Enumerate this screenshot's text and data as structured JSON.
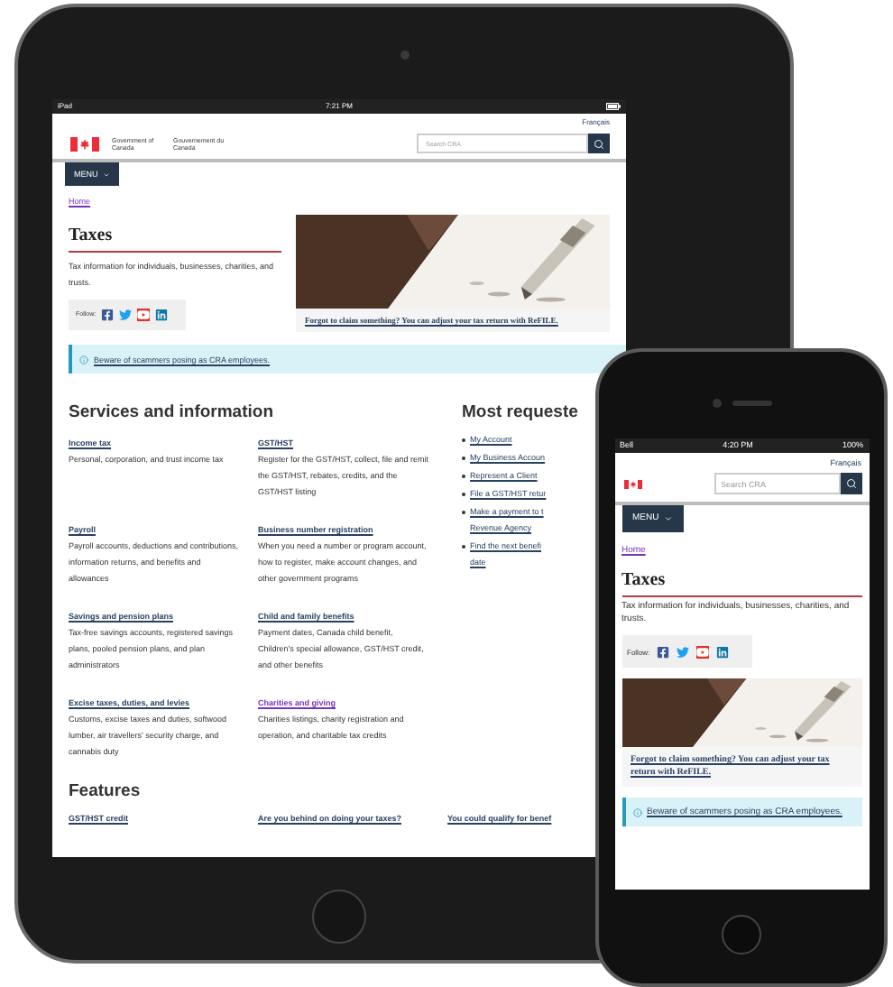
{
  "tablet": {
    "status_bar": {
      "carrier": "iPad",
      "time": "7:21 PM"
    },
    "header": {
      "language_link": "Français",
      "wordmark_en": "Government of Canada",
      "wordmark_fr": "Gouvernement du Canada",
      "search": {
        "placeholder": "Search CRA"
      },
      "menu": "MENU"
    },
    "breadcrumb": "Home",
    "title": "Taxes",
    "intro": "Tax information for individuals, businesses, charities, and trusts.",
    "follow_label": "Follow:",
    "feature_caption": "Forgot to claim something? You can adjust your tax return with ReFILE.",
    "alert": "Beware of scammers posing as CRA employees.",
    "services": {
      "heading": "Services and information",
      "items": [
        {
          "title": "Income tax",
          "visited": false,
          "description": "Personal, corporation, and trust income tax"
        },
        {
          "title": "GST/HST",
          "visited": false,
          "description": "Register for the GST/HST, collect, file and remit the GST/HST, rebates, credits, and the GST/HST listing"
        },
        {
          "title": "Payroll",
          "visited": false,
          "description": "Payroll accounts, deductions and contributions, information returns, and benefits and allowances"
        },
        {
          "title": "Business number registration",
          "visited": false,
          "description": "When you need a number or program account, how to register, make account changes, and other government programs"
        },
        {
          "title": "Savings and pension plans",
          "visited": false,
          "description": "Tax-free savings accounts, registered savings plans, pooled pension plans, and plan administrators"
        },
        {
          "title": "Child and family benefits",
          "visited": false,
          "description": "Payment dates, Canada child benefit, Children's special allowance, GST/HST credit, and other benefits"
        },
        {
          "title": "Excise taxes, duties, and levies",
          "visited": false,
          "description": "Customs, excise taxes and duties, softwood lumber, air travellers' security charge, and cannabis duty"
        },
        {
          "title": "Charities and giving",
          "visited": true,
          "description": "Charities listings, charity registration and operation, and charitable tax credits"
        }
      ]
    },
    "most_requested": {
      "heading": "Most requeste",
      "items": [
        {
          "lines": [
            "My Account"
          ]
        },
        {
          "lines": [
            "My Business Accoun"
          ]
        },
        {
          "lines": [
            "Represent a Client"
          ]
        },
        {
          "lines": [
            "File a GST/HST retur"
          ]
        },
        {
          "lines": [
            "Make a payment to t",
            "Revenue Agency"
          ]
        },
        {
          "lines": [
            "Find the next benefi",
            "date"
          ]
        }
      ]
    },
    "features": {
      "heading": "Features",
      "links": [
        "GST/HST credit",
        "Are you behind on doing your taxes?",
        "You could qualify for benef"
      ]
    }
  },
  "phone": {
    "status_bar": {
      "carrier": "Bell",
      "time": "4:20 PM",
      "battery": "100%"
    },
    "header": {
      "language_link": "Français",
      "search": {
        "placeholder": "Search CRA"
      },
      "menu": "MENU"
    },
    "breadcrumb": "Home",
    "title": "Taxes",
    "intro": "Tax information for individuals, businesses, charities, and trusts.",
    "follow_label": "Follow:",
    "feature_caption": "Forgot to claim something? You can adjust your tax return with ReFILE.",
    "alert": "Beware of scammers posing as CRA employees."
  }
}
